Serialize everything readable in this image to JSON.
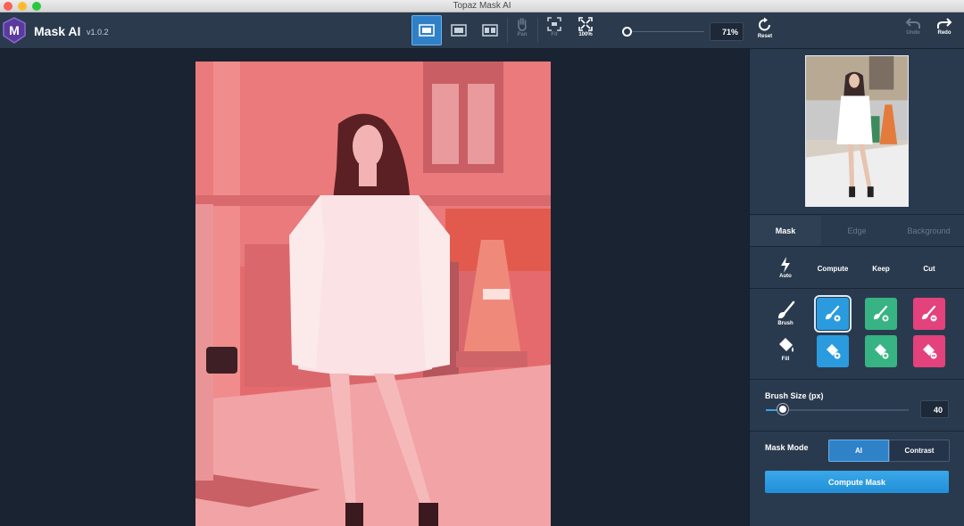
{
  "window": {
    "title": "Topaz Mask AI"
  },
  "app": {
    "name": "Mask AI",
    "version": "v1.0.2",
    "logo_letter": "M"
  },
  "toolbar": {
    "view_modes": [
      "single-view-icon",
      "split-view-icon",
      "side-by-side-view-icon"
    ],
    "pan_label": "Pan",
    "fit_label": "Fit",
    "full_label": "100%",
    "zoom_value": "71%",
    "zoom_fraction": 0.0,
    "reset_label": "Reset",
    "undo_label": "Undo",
    "redo_label": "Redo"
  },
  "panel": {
    "tabs": [
      {
        "label": "Mask",
        "active": true
      },
      {
        "label": "Edge",
        "active": false
      },
      {
        "label": "Background",
        "active": false
      }
    ],
    "auto_label": "Auto",
    "columns": [
      "Compute",
      "Keep",
      "Cut"
    ],
    "brush_label": "Brush",
    "fill_label": "Fill",
    "brush_size_label": "Brush Size (px)",
    "brush_size_value": "40",
    "brush_size_fraction": 0.12,
    "mask_mode_label": "Mask Mode",
    "mask_modes": [
      {
        "label": "AI",
        "active": true
      },
      {
        "label": "Contrast",
        "active": false
      }
    ],
    "compute_button": "Compute Mask"
  },
  "colors": {
    "compute": "#2b9be0",
    "keep": "#37b384",
    "cut": "#e3427c",
    "overlay": "#ff6f74"
  }
}
